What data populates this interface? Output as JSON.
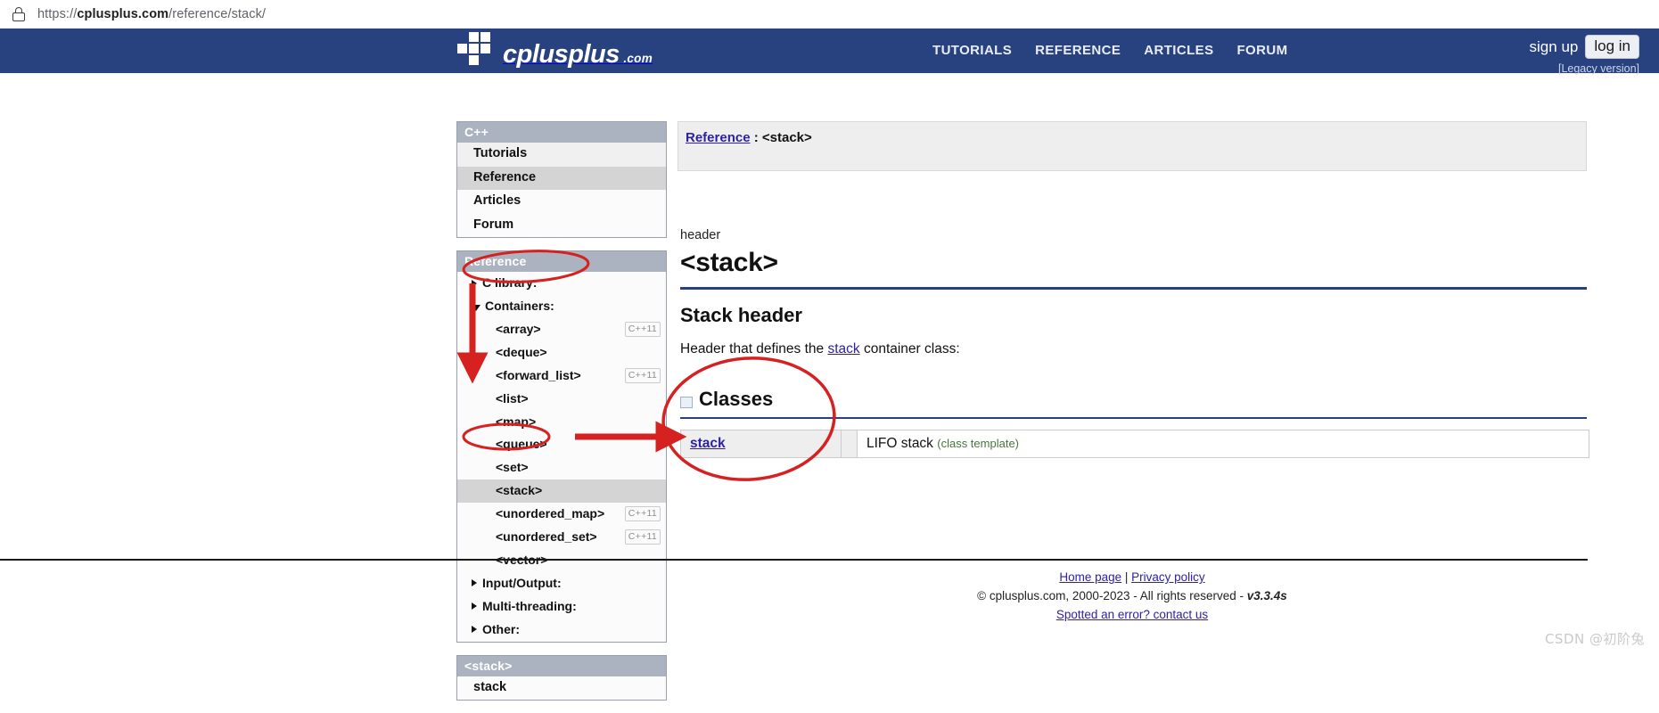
{
  "browser": {
    "lock_icon": "lock-icon",
    "url_prefix": "https://",
    "url_domain": "cplusplus.com",
    "url_path": "/reference/stack/"
  },
  "header": {
    "logo_name": "cplusplus",
    "logo_suffix": ".com",
    "nav": [
      {
        "label": "TUTORIALS"
      },
      {
        "label": "REFERENCE"
      },
      {
        "label": "ARTICLES"
      },
      {
        "label": "FORUM"
      }
    ],
    "sign_up": "sign up",
    "log_in": "log in",
    "legacy": "[Legacy version]",
    "brand_color": "#27427f"
  },
  "sidebar": {
    "cpp_panel": {
      "title": "C++",
      "items": [
        {
          "label": "Tutorials",
          "selected": false
        },
        {
          "label": "Reference",
          "selected": true
        },
        {
          "label": "Articles",
          "selected": false
        },
        {
          "label": "Forum",
          "selected": false
        }
      ]
    },
    "reference_panel": {
      "title": "Reference",
      "items": [
        {
          "label": "C library:",
          "type": "group",
          "expanded": false,
          "badge": ""
        },
        {
          "label": "Containers:",
          "type": "group",
          "expanded": true,
          "badge": ""
        },
        {
          "label": "<array>",
          "type": "child",
          "badge": "C++11",
          "selected": false
        },
        {
          "label": "<deque>",
          "type": "child",
          "badge": "",
          "selected": false
        },
        {
          "label": "<forward_list>",
          "type": "child",
          "badge": "C++11",
          "selected": false
        },
        {
          "label": "<list>",
          "type": "child",
          "badge": "",
          "selected": false
        },
        {
          "label": "<map>",
          "type": "child",
          "badge": "",
          "selected": false
        },
        {
          "label": "<queue>",
          "type": "child",
          "badge": "",
          "selected": false
        },
        {
          "label": "<set>",
          "type": "child",
          "badge": "",
          "selected": false
        },
        {
          "label": "<stack>",
          "type": "child",
          "badge": "",
          "selected": true
        },
        {
          "label": "<unordered_map>",
          "type": "child",
          "badge": "C++11",
          "selected": false
        },
        {
          "label": "<unordered_set>",
          "type": "child",
          "badge": "C++11",
          "selected": false
        },
        {
          "label": "<vector>",
          "type": "child",
          "badge": "",
          "selected": false
        },
        {
          "label": "Input/Output:",
          "type": "group",
          "expanded": false,
          "badge": ""
        },
        {
          "label": "Multi-threading:",
          "type": "group",
          "expanded": false,
          "badge": ""
        },
        {
          "label": "Other:",
          "type": "group",
          "expanded": false,
          "badge": ""
        }
      ]
    },
    "stack_panel": {
      "title": "<stack>",
      "items": [
        {
          "label": "stack"
        }
      ]
    }
  },
  "main": {
    "breadcrumb_link": "Reference",
    "breadcrumb_sep": " : ",
    "breadcrumb_current": "<stack>",
    "kicker": "header",
    "title": "<stack>",
    "subtitle": "Stack header",
    "description_before": "Header that defines the ",
    "description_link": "stack",
    "description_after": " container class:",
    "classes_section": {
      "icon": "expand-box-icon",
      "heading": "Classes",
      "rows": [
        {
          "name": "stack",
          "description": "LIFO stack",
          "qualifier": "(class template)"
        }
      ]
    }
  },
  "footer": {
    "home_page": "Home page",
    "separator": " | ",
    "privacy": "Privacy policy",
    "copyright": "© cplusplus.com, 2000-2023 - All rights reserved - ",
    "version": "v3.3.4s",
    "contact": "Spotted an error? contact us"
  },
  "annotations": {
    "color": "#d62121",
    "ellipse_containers": "red-ellipse-containers",
    "arrow_down": "red-arrow-down",
    "ellipse_stack": "red-ellipse-stack",
    "arrow_right": "red-arrow-right",
    "ellipse_classes": "red-ellipse-classes"
  },
  "watermark": {
    "text": "CSDN @初阶兔"
  }
}
